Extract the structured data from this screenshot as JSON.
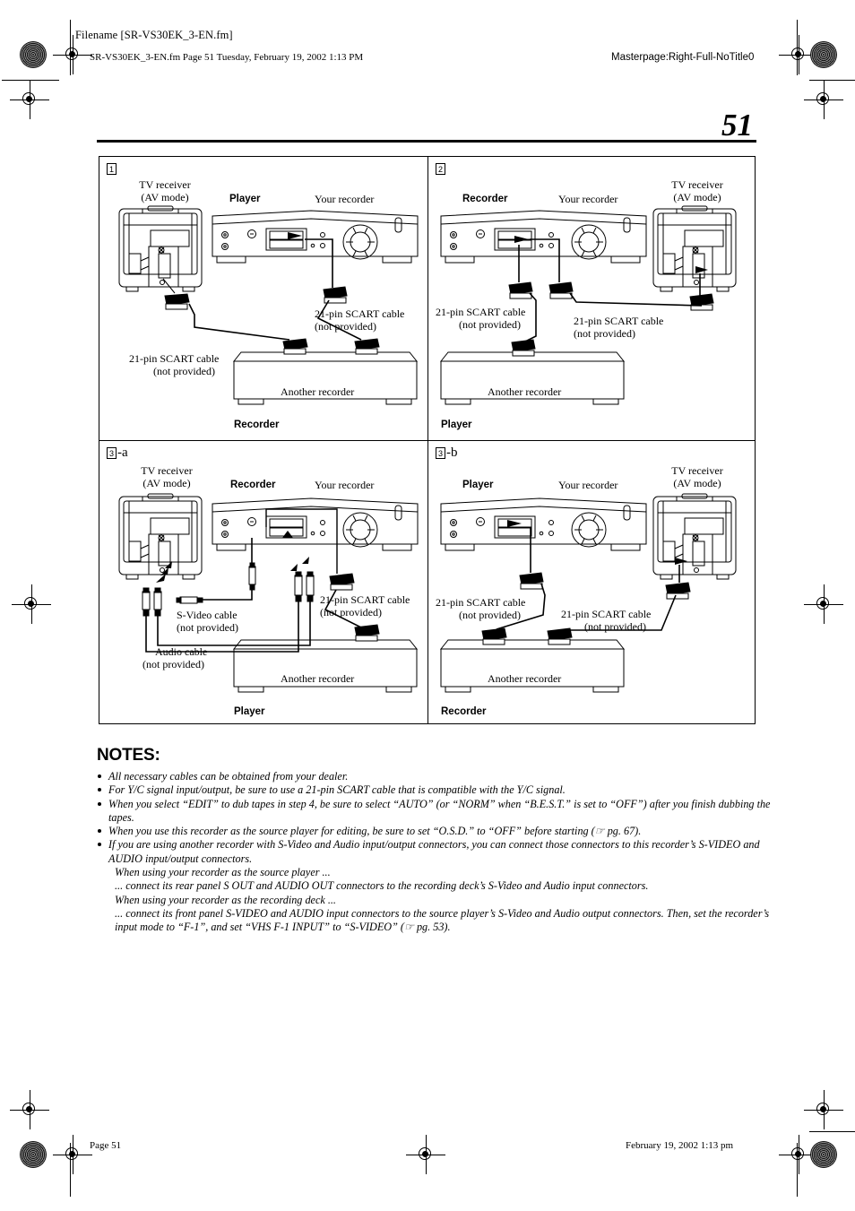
{
  "header": {
    "filename": "Filename [SR-VS30EK_3-EN.fm]",
    "path_line": "SR-VS30EK_3-EN.fm  Page 51  Tuesday, February 19, 2002  1:13 PM",
    "masterpage": "Masterpage:Right-Full-NoTitle0"
  },
  "page_number": "51",
  "footer": {
    "left": "Page 51",
    "right": "February 19, 2002 1:13 pm"
  },
  "figure": {
    "panels": [
      {
        "id": "panel-1",
        "step": "1",
        "step_suffix": "",
        "labels": {
          "tv": "TV receiver",
          "tv_mode": "(AV mode)",
          "left_role": "Player",
          "your_recorder": "Your recorder",
          "another_recorder": "Another recorder",
          "bottom_role": "Recorder",
          "cable_a_1": "21-pin SCART cable",
          "cable_a_2": "(not provided)",
          "cable_b_1": "21-pin SCART cable",
          "cable_b_2": "(not provided)"
        }
      },
      {
        "id": "panel-2",
        "step": "2",
        "step_suffix": "",
        "labels": {
          "tv": "TV receiver",
          "tv_mode": "(AV mode)",
          "left_role": "Recorder",
          "your_recorder": "Your recorder",
          "another_recorder": "Another recorder",
          "bottom_role": "Player",
          "cable_a_1": "21-pin SCART cable",
          "cable_a_2": "(not provided)",
          "cable_b_1": "21-pin SCART cable",
          "cable_b_2": "(not provided)"
        }
      },
      {
        "id": "panel-3a",
        "step": "3",
        "step_suffix": "-a",
        "labels": {
          "tv": "TV receiver",
          "tv_mode": "(AV mode)",
          "left_role": "Recorder",
          "your_recorder": "Your recorder",
          "another_recorder": "Another recorder",
          "bottom_role": "Player",
          "cable_a_1": "S-Video cable",
          "cable_a_2": "(not provided)",
          "cable_b_1": "21-pin SCART cable",
          "cable_b_2": "(not provided)",
          "cable_c_1": "Audio cable",
          "cable_c_2": "(not provided)"
        }
      },
      {
        "id": "panel-3b",
        "step": "3",
        "step_suffix": "-b",
        "labels": {
          "tv": "TV receiver",
          "tv_mode": "(AV mode)",
          "left_role": "Player",
          "your_recorder": "Your recorder",
          "another_recorder": "Another recorder",
          "bottom_role": "Recorder",
          "cable_a_1": "21-pin SCART cable",
          "cable_a_2": "(not provided)",
          "cable_b_1": "21-pin SCART cable",
          "cable_b_2": "(not provided)"
        }
      }
    ]
  },
  "notes": {
    "title": "NOTES:",
    "items": [
      {
        "text": "All necessary cables can be obtained from your dealer.",
        "subs": []
      },
      {
        "text": "For Y/C signal input/output, be sure to use a 21-pin SCART cable that is compatible with the Y/C signal.",
        "subs": []
      },
      {
        "text": "When you select “EDIT” to dub tapes in step 4, be sure to select “AUTO” (or “NORM” when “B.E.S.T.” is set to “OFF”) after you finish dubbing the tapes.",
        "subs": []
      },
      {
        "text": "When you use this recorder as the source player for editing, be sure to set “O.S.D.” to “OFF” before starting (☞ pg. 67).",
        "subs": []
      },
      {
        "text": "If you are using another recorder with S-Video and Audio input/output connectors, you can connect those connectors to this recorder’s S-VIDEO and AUDIO input/output connectors.",
        "subs": [
          "When using your recorder as the source player ...",
          "... connect its rear panel S OUT and AUDIO OUT connectors to the recording deck’s S-Video and Audio input connectors.",
          "When using your recorder as the recording deck ...",
          "... connect its front panel S-VIDEO and AUDIO input connectors to the source player’s S-Video and Audio output connectors. Then, set the recorder’s input mode to “F-1”, and set “VHS F-1 INPUT” to “S-VIDEO” (☞ pg. 53)."
        ]
      }
    ]
  }
}
